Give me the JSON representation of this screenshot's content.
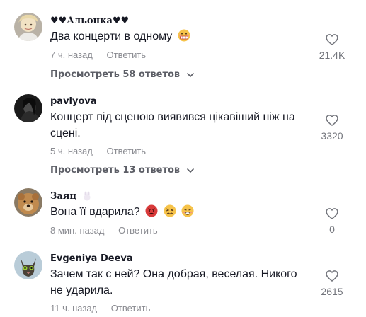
{
  "comments": [
    {
      "author": "♥♥Альонка♥♥",
      "text": "Два концерти в одному",
      "time": "7 ч. назад",
      "reply_label": "Ответить",
      "likes": "21.4K",
      "replies_label": "Просмотреть 58 ответов"
    },
    {
      "author": "pavlyova",
      "text": "Концерт під сценою виявився цікавіший ніж на сцені.",
      "time": "5 ч. назад",
      "reply_label": "Ответить",
      "likes": "3320",
      "replies_label": "Просмотреть 13 ответов"
    },
    {
      "author": "Заяц",
      "text": "Вона її вдарила?",
      "time": "8 мин. назад",
      "reply_label": "Ответить",
      "likes": "0"
    },
    {
      "author": "Evgeniya Deeva",
      "text": "Зачем так с ней? Она добрая, веселая. Никого не ударила.",
      "time": "11 ч. назад",
      "reply_label": "Ответить",
      "likes": "2615"
    }
  ],
  "icons": {
    "like": "heart-outline-icon",
    "expand": "chevron-down-icon"
  },
  "colors": {
    "text": "#161823",
    "muted": "#8a8b91",
    "replies": "#5c5e66"
  }
}
